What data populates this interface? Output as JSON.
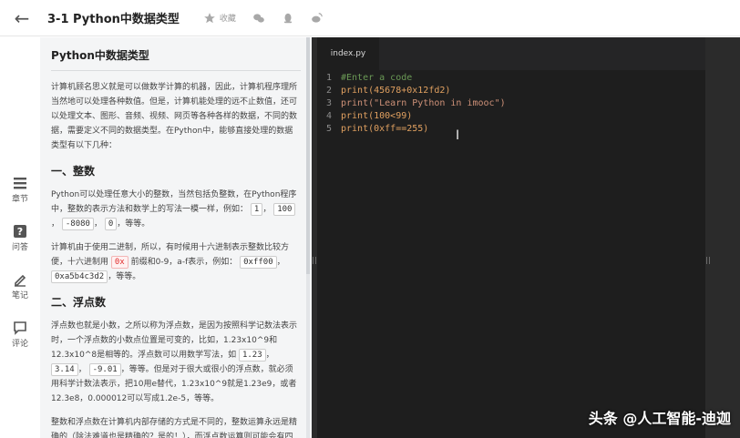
{
  "header": {
    "title": "3-1 Python中数据类型",
    "favorite_label": "收藏"
  },
  "rail": [
    {
      "label": "章节"
    },
    {
      "label": "问答"
    },
    {
      "label": "笔记"
    },
    {
      "label": "评论"
    }
  ],
  "article": {
    "title": "Python中数据类型",
    "intro": "计算机顾名思义就是可以做数学计算的机器，因此，计算机程序理所当然地可以处理各种数值。但是，计算机能处理的远不止数值，还可以处理文本、图形、音频、视频、网页等各种各样的数据，不同的数据，需要定义不同的数据类型。在Python中，能够直接处理的数据类型有以下几种：",
    "sec1_title": "一、整数",
    "sec1_p1_a": "Python可以处理任意大小的整数，当然包括负整数，在Python程序中，整数的表示方法和数学上的写法一模一样，例如：",
    "sec1_c1": "1",
    "sec1_c2": "100",
    "sec1_c3": "-8080",
    "sec1_c4": "0",
    "sec1_p1_end": "，等等。",
    "sec1_p2_a": "计算机由于使用二进制，所以，有时候用十六进制表示整数比较方便，十六进制用",
    "sec1_c5": "0x",
    "sec1_p2_b": "前缀和0-9，a-f表示，例如：",
    "sec1_c6": "0xff00",
    "sec1_c7": "0xa5b4c3d2",
    "sec1_p2_end": "，等等。",
    "sec2_title": "二、浮点数",
    "sec2_p1_a": "浮点数也就是小数，之所以称为浮点数，是因为按照科学记数法表示时，一个浮点数的小数点位置是可变的，比如，1.23x10^9和12.3x10^8是相等的。浮点数可以用数学写法，如",
    "sec2_c1": "1.23",
    "sec2_c2": "3.14",
    "sec2_c3": "-9.01",
    "sec2_p1_b": "，等等。但是对于很大或很小的浮点数，就必须用科学计数法表示，把10用e替代，1.23x10^9就是1.23e9，或者12.3e8，0.000012可以写成1.2e-5，等等。",
    "sec2_p2": "整数和浮点数在计算机内部存储的方式是不同的，整数运算永远是精确的（除法难道也是精确的？是的！），而浮点数运算则可能会有四"
  },
  "editor": {
    "tab": "index.py",
    "lines": [
      {
        "n": "1",
        "text": "#Enter a code"
      },
      {
        "n": "2",
        "text": "print(45678+0x12fd2)"
      },
      {
        "n": "3",
        "text": "print(\"Learn Python in imooc\")"
      },
      {
        "n": "4",
        "text": "print(100<99)"
      },
      {
        "n": "5",
        "text": "print(0xff==255)"
      }
    ]
  },
  "watermark": "头条 @人工智能-迪迦"
}
